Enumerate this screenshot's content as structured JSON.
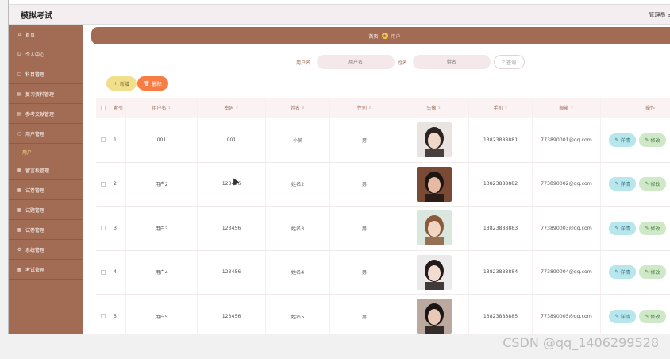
{
  "app": {
    "title": "模拟考试",
    "admin_label": "管理员 a"
  },
  "sidebar": {
    "items": [
      {
        "label": "首页",
        "icon": "home-icon"
      },
      {
        "label": "个人中心",
        "icon": "user-icon"
      },
      {
        "label": "科目管理",
        "icon": "book-icon"
      },
      {
        "label": "复习资料管理",
        "icon": "file-icon"
      },
      {
        "label": "参考文献管理",
        "icon": "file-icon"
      },
      {
        "label": "用户管理",
        "icon": "users-icon"
      },
      {
        "label": "留言板管理",
        "icon": "grid-icon"
      },
      {
        "label": "试卷管理",
        "icon": "grid-icon"
      },
      {
        "label": "试题管理",
        "icon": "grid-icon"
      },
      {
        "label": "试卷管理",
        "icon": "grid-icon"
      },
      {
        "label": "系统管理",
        "icon": "gear-icon"
      },
      {
        "label": "考试管理",
        "icon": "grid-icon"
      }
    ],
    "submenu": {
      "label": "用户"
    }
  },
  "breadcrumb": {
    "home": "首页",
    "current": "用户"
  },
  "search": {
    "username_label": "用户名",
    "username_placeholder": "用户名",
    "name_label": "姓名",
    "name_placeholder": "姓名",
    "button": "查询"
  },
  "actions": {
    "add": "新增",
    "delete": "删除"
  },
  "table": {
    "headers": [
      "索引",
      "用户名",
      "密码",
      "姓名",
      "性别",
      "头像",
      "手机",
      "邮箱",
      "操作"
    ],
    "detail_label": "详情",
    "edit_label": "修改",
    "rows": [
      {
        "idx": "1",
        "user": "001",
        "pwd": "001",
        "name": "小吴",
        "sex": "男",
        "phone": "13823888881",
        "mail": "773890001@qq.com"
      },
      {
        "idx": "2",
        "user": "用户2",
        "pwd": "123456",
        "name": "姓名2",
        "sex": "男",
        "phone": "13823888882",
        "mail": "773890002@qq.com"
      },
      {
        "idx": "3",
        "user": "用户3",
        "pwd": "123456",
        "name": "姓名3",
        "sex": "男",
        "phone": "13823888883",
        "mail": "773890003@qq.com"
      },
      {
        "idx": "4",
        "user": "用户4",
        "pwd": "123456",
        "name": "姓名4",
        "sex": "男",
        "phone": "13823888884",
        "mail": "773890004@qq.com"
      },
      {
        "idx": "5",
        "user": "用户5",
        "pwd": "123456",
        "name": "姓名5",
        "sex": "男",
        "phone": "13823888885",
        "mail": "773890005@qq.com"
      }
    ]
  },
  "watermark": "CSDN @qq_1406299528"
}
